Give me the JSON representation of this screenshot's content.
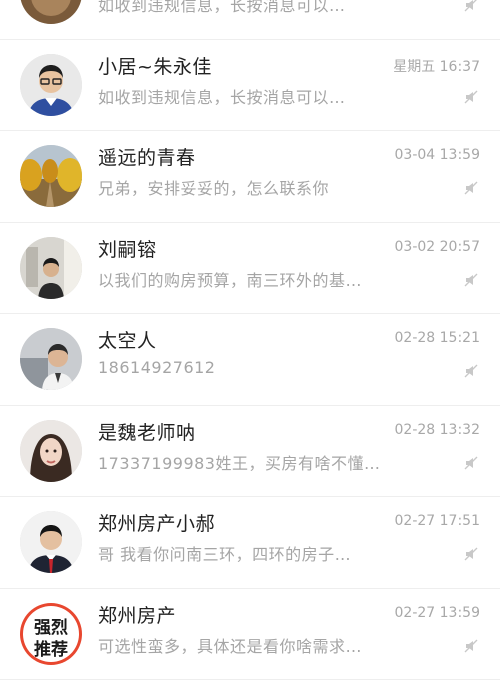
{
  "conversations": [
    {
      "name": "",
      "preview": "如收到违规信息，长按消息可以…",
      "time": "",
      "muted": true,
      "avatar": "cat-photo-avatar"
    },
    {
      "name": "小居~朱永佳",
      "preview": "如收到违规信息，长按消息可以…",
      "time": "星期五 16:37",
      "muted": true,
      "avatar": "man-glasses-avatar"
    },
    {
      "name": "遥远的青春",
      "preview": "兄弟，安排妥妥的，怎么联系你",
      "time": "03-04 13:59",
      "muted": true,
      "avatar": "autumn-trees-avatar"
    },
    {
      "name": "刘嗣镕",
      "preview": "以我们的购房预算，南三环外的基…",
      "time": "03-02 20:57",
      "muted": true,
      "avatar": "man-seated-avatar"
    },
    {
      "name": "太空人",
      "preview": "18614927612",
      "time": "02-28 15:21",
      "muted": true,
      "avatar": "man-suit-avatar"
    },
    {
      "name": "是魏老师呐",
      "preview": "17337199983姓王，买房有啥不懂…",
      "time": "02-28 13:32",
      "muted": true,
      "avatar": "woman-portrait-avatar"
    },
    {
      "name": "郑州房产小郝",
      "preview": "哥   我看你问南三环，四环的房子…",
      "time": "02-27 17:51",
      "muted": true,
      "avatar": "man-redtie-avatar"
    },
    {
      "name": "郑州房产",
      "preview": "可选性蛮多，具体还是看你啥需求…",
      "time": "02-27 13:59",
      "muted": true,
      "avatar": "recommend-badge-avatar",
      "badge_lines": [
        "强烈",
        "推荐"
      ]
    }
  ],
  "colors": {
    "name": "#222222",
    "preview": "#a5a5a5",
    "time": "#a8a8a8",
    "badge_ring": "#e8472f"
  }
}
